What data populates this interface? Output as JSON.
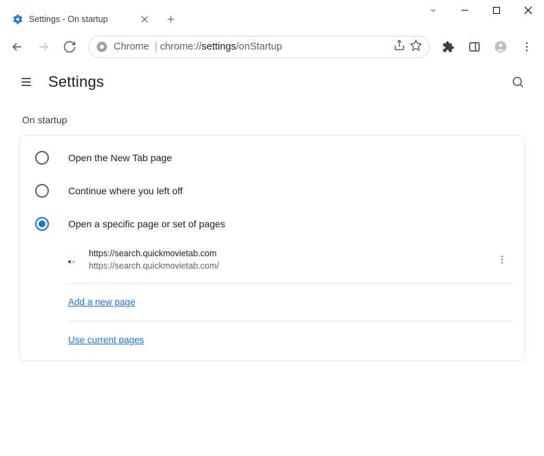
{
  "window": {
    "tab_title": "Settings - On startup",
    "address_scheme": "Chrome",
    "address_host": "chrome://",
    "address_path_prefix": "settings",
    "address_path_suffix": "/onStartup"
  },
  "header": {
    "title": "Settings"
  },
  "section": {
    "title": "On startup",
    "options": [
      {
        "label": "Open the New Tab page",
        "checked": false
      },
      {
        "label": "Continue where you left off",
        "checked": false
      },
      {
        "label": "Open a specific page or set of pages",
        "checked": true
      }
    ],
    "pages": [
      {
        "name": "https://search.quickmovietab.com",
        "url": "https://search.quickmovietab.com/"
      }
    ],
    "add_page_label": "Add a new page",
    "use_current_label": "Use current pages"
  }
}
